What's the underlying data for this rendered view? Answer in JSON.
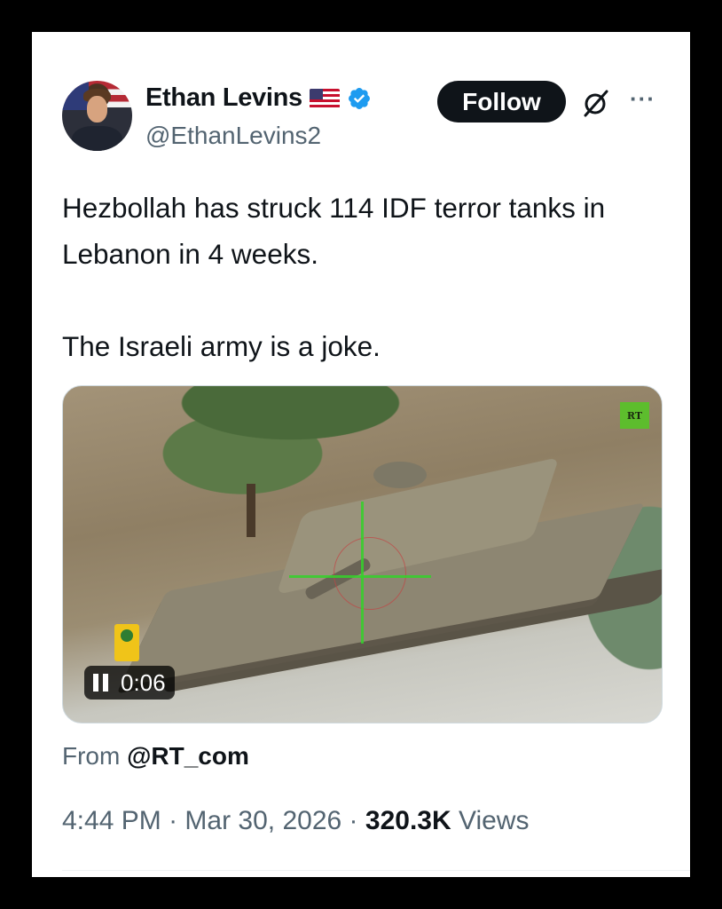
{
  "author": {
    "name": "Ethan Levins",
    "handle": "@EthanLevins2",
    "flag_icon": "us-flag-icon",
    "verified_icon": "verified-badge-icon"
  },
  "actions": {
    "follow_label": "Follow",
    "grok_icon": "grok-icon",
    "more_icon": "more-options-icon",
    "more_glyph": "···"
  },
  "tweet": {
    "text": "Hezbollah has struck 114 IDF terror tanks in Lebanon in 4 weeks.\n\nThe Israeli army is a joke."
  },
  "media": {
    "type": "video",
    "watermark": "RT",
    "timer": "0:06",
    "state": "playing"
  },
  "source": {
    "prefix": "From",
    "account": "@RT_com"
  },
  "meta": {
    "time": "4:44 PM",
    "separator": "·",
    "date": "Mar 30, 2026",
    "views_count": "320.3K",
    "views_label": "Views"
  },
  "colors": {
    "text_primary": "#0f1419",
    "text_secondary": "#536471",
    "verified_blue": "#1d9bf0",
    "rt_green": "#5dbd2d"
  }
}
